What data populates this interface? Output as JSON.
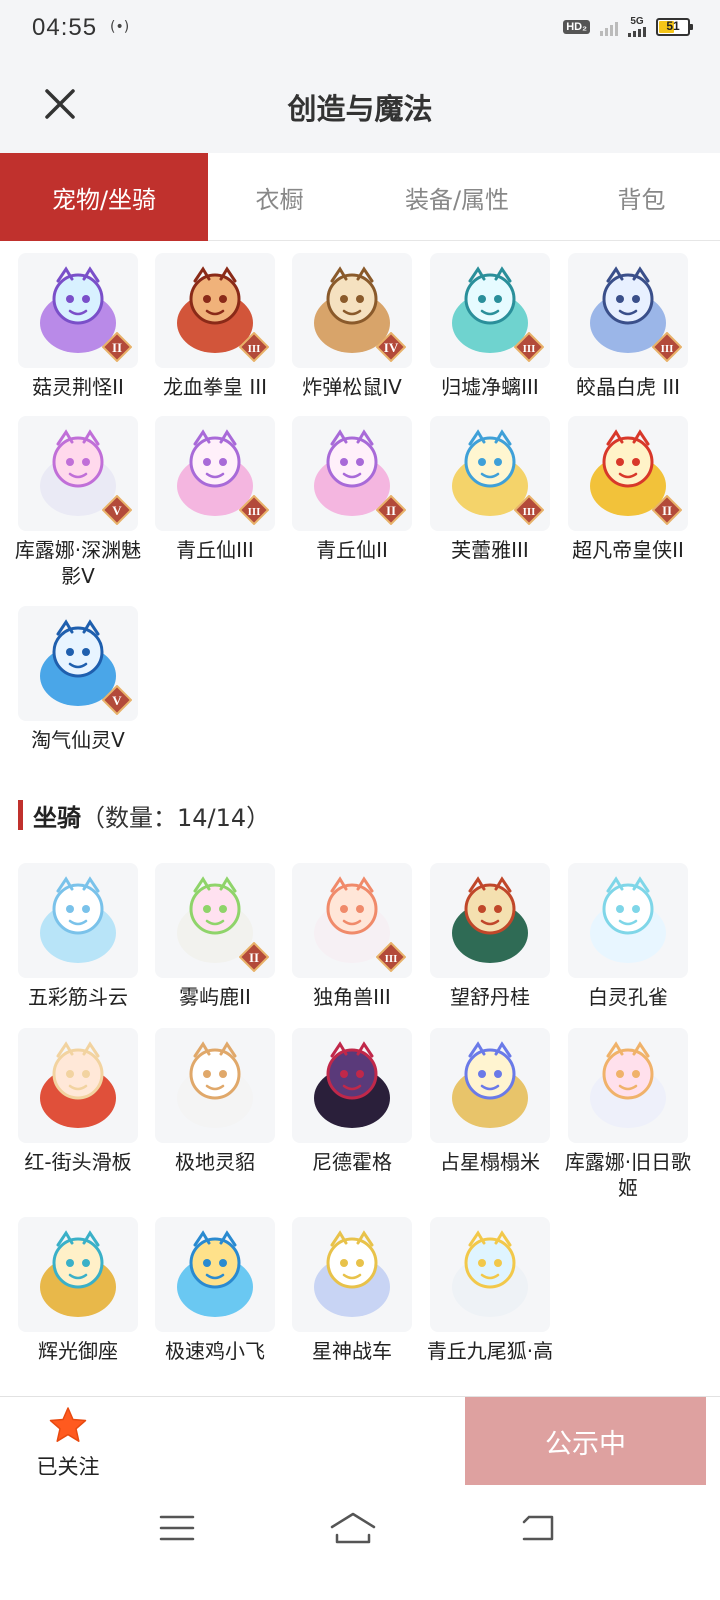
{
  "status_bar": {
    "time": "04:55",
    "radio": "(•)",
    "hd": "HD₂",
    "network": "5G",
    "battery": "51",
    "battery_level": 0.51
  },
  "header": {
    "title": "创造与魔法"
  },
  "tabs": [
    {
      "label": "宠物/坐骑",
      "active": true
    },
    {
      "label": "衣橱",
      "active": false
    },
    {
      "label": "装备/属性",
      "active": false
    },
    {
      "label": "背包",
      "active": false
    }
  ],
  "pets": [
    {
      "name": "菇灵荆怪II",
      "rank": "II",
      "icon": "purple-mushroom-sprite"
    },
    {
      "name": "龙血拳皇 III",
      "rank": "III",
      "icon": "red-horned-beast"
    },
    {
      "name": "炸弹松鼠IV",
      "rank": "IV",
      "icon": "bomb-squirrel"
    },
    {
      "name": "归墟净螭III",
      "rank": "III",
      "icon": "teal-dragon"
    },
    {
      "name": "皎晶白虎 III",
      "rank": "III",
      "icon": "crystal-white-tiger"
    },
    {
      "name": "库露娜·深渊魅影V",
      "rank": "V",
      "icon": "white-hair-girl"
    },
    {
      "name": "青丘仙III",
      "rank": "III",
      "icon": "fox-fairy"
    },
    {
      "name": "青丘仙II",
      "rank": "II",
      "icon": "fox-fairy"
    },
    {
      "name": "芙蕾雅III",
      "rank": "III",
      "icon": "golden-winged-girl"
    },
    {
      "name": "超凡帝皇侠II",
      "rank": "II",
      "icon": "golden-armor-hero"
    },
    {
      "name": "淘气仙灵V",
      "rank": "V",
      "icon": "blue-puppy"
    }
  ],
  "mounts_section": {
    "title": "坐骑",
    "count_text": "（数量：14/14）"
  },
  "mounts": [
    {
      "name": "五彩筋斗云",
      "rank": "",
      "icon": "blue-cloud"
    },
    {
      "name": "雾屿鹿II",
      "rank": "II",
      "icon": "white-deer"
    },
    {
      "name": "独角兽III",
      "rank": "III",
      "icon": "unicorn"
    },
    {
      "name": "望舒丹桂",
      "rank": "",
      "icon": "osmanthus-swing"
    },
    {
      "name": "白灵孔雀",
      "rank": "",
      "icon": "white-peacock"
    },
    {
      "name": "红-街头滑板",
      "rank": "",
      "icon": "red-skateboard"
    },
    {
      "name": "极地灵貂",
      "rank": "",
      "icon": "polar-marten"
    },
    {
      "name": "尼德霍格",
      "rank": "",
      "icon": "dark-dragon"
    },
    {
      "name": "占星榻榻米",
      "rank": "",
      "icon": "astrology-dome"
    },
    {
      "name": "库露娜·旧日歌姬",
      "rank": "",
      "icon": "white-hair-singer"
    },
    {
      "name": "辉光御座",
      "rank": "",
      "icon": "golden-throne"
    },
    {
      "name": "极速鸡小飞",
      "rank": "",
      "icon": "blue-chick"
    },
    {
      "name": "星神战车",
      "rank": "",
      "icon": "star-chariot-beast"
    },
    {
      "name": "青丘九尾狐·高",
      "rank": "",
      "icon": "nine-tail-fox"
    }
  ],
  "bottom": {
    "follow_label": "已关注",
    "publicity_label": "公示中"
  },
  "nav": {
    "menu": "menu-icon",
    "home": "home-icon",
    "back": "back-icon"
  },
  "colors": {
    "accent": "#c0312d",
    "publicity": "#dea1a0",
    "follow_star": "#ff5a1f"
  }
}
